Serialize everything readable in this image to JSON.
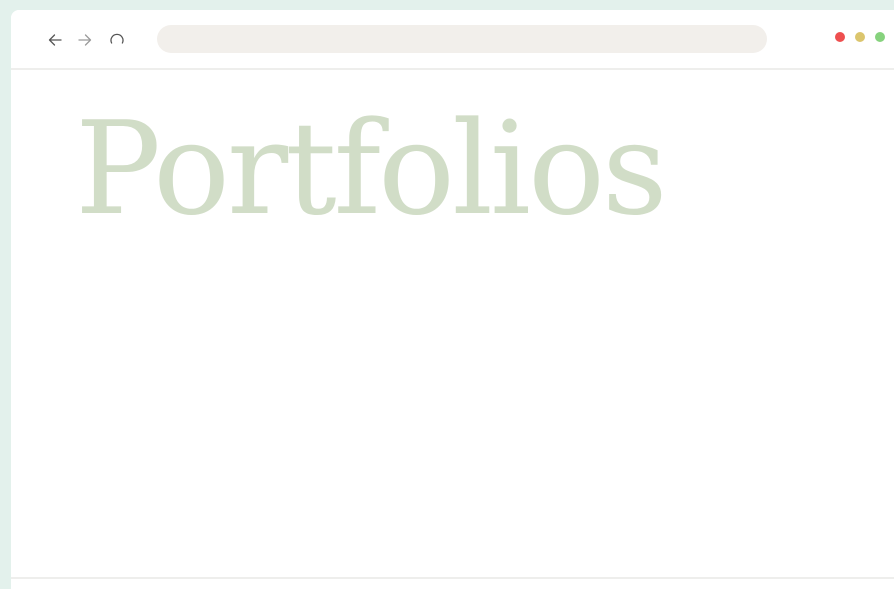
{
  "browser": {
    "address_bar": {
      "value": "",
      "placeholder": ""
    },
    "nav_icons": {
      "back": "arrow-left-icon",
      "forward": "arrow-right-icon",
      "reload": "reload-icon"
    },
    "window_controls": [
      {
        "name": "close",
        "color": "#ee4f4f"
      },
      {
        "name": "minimize",
        "color": "#dbc56d"
      },
      {
        "name": "maximize",
        "color": "#86d27d"
      }
    ]
  },
  "page": {
    "title": "Portfolios",
    "title_color": "#d1ddc7",
    "background": "#ffffff"
  }
}
